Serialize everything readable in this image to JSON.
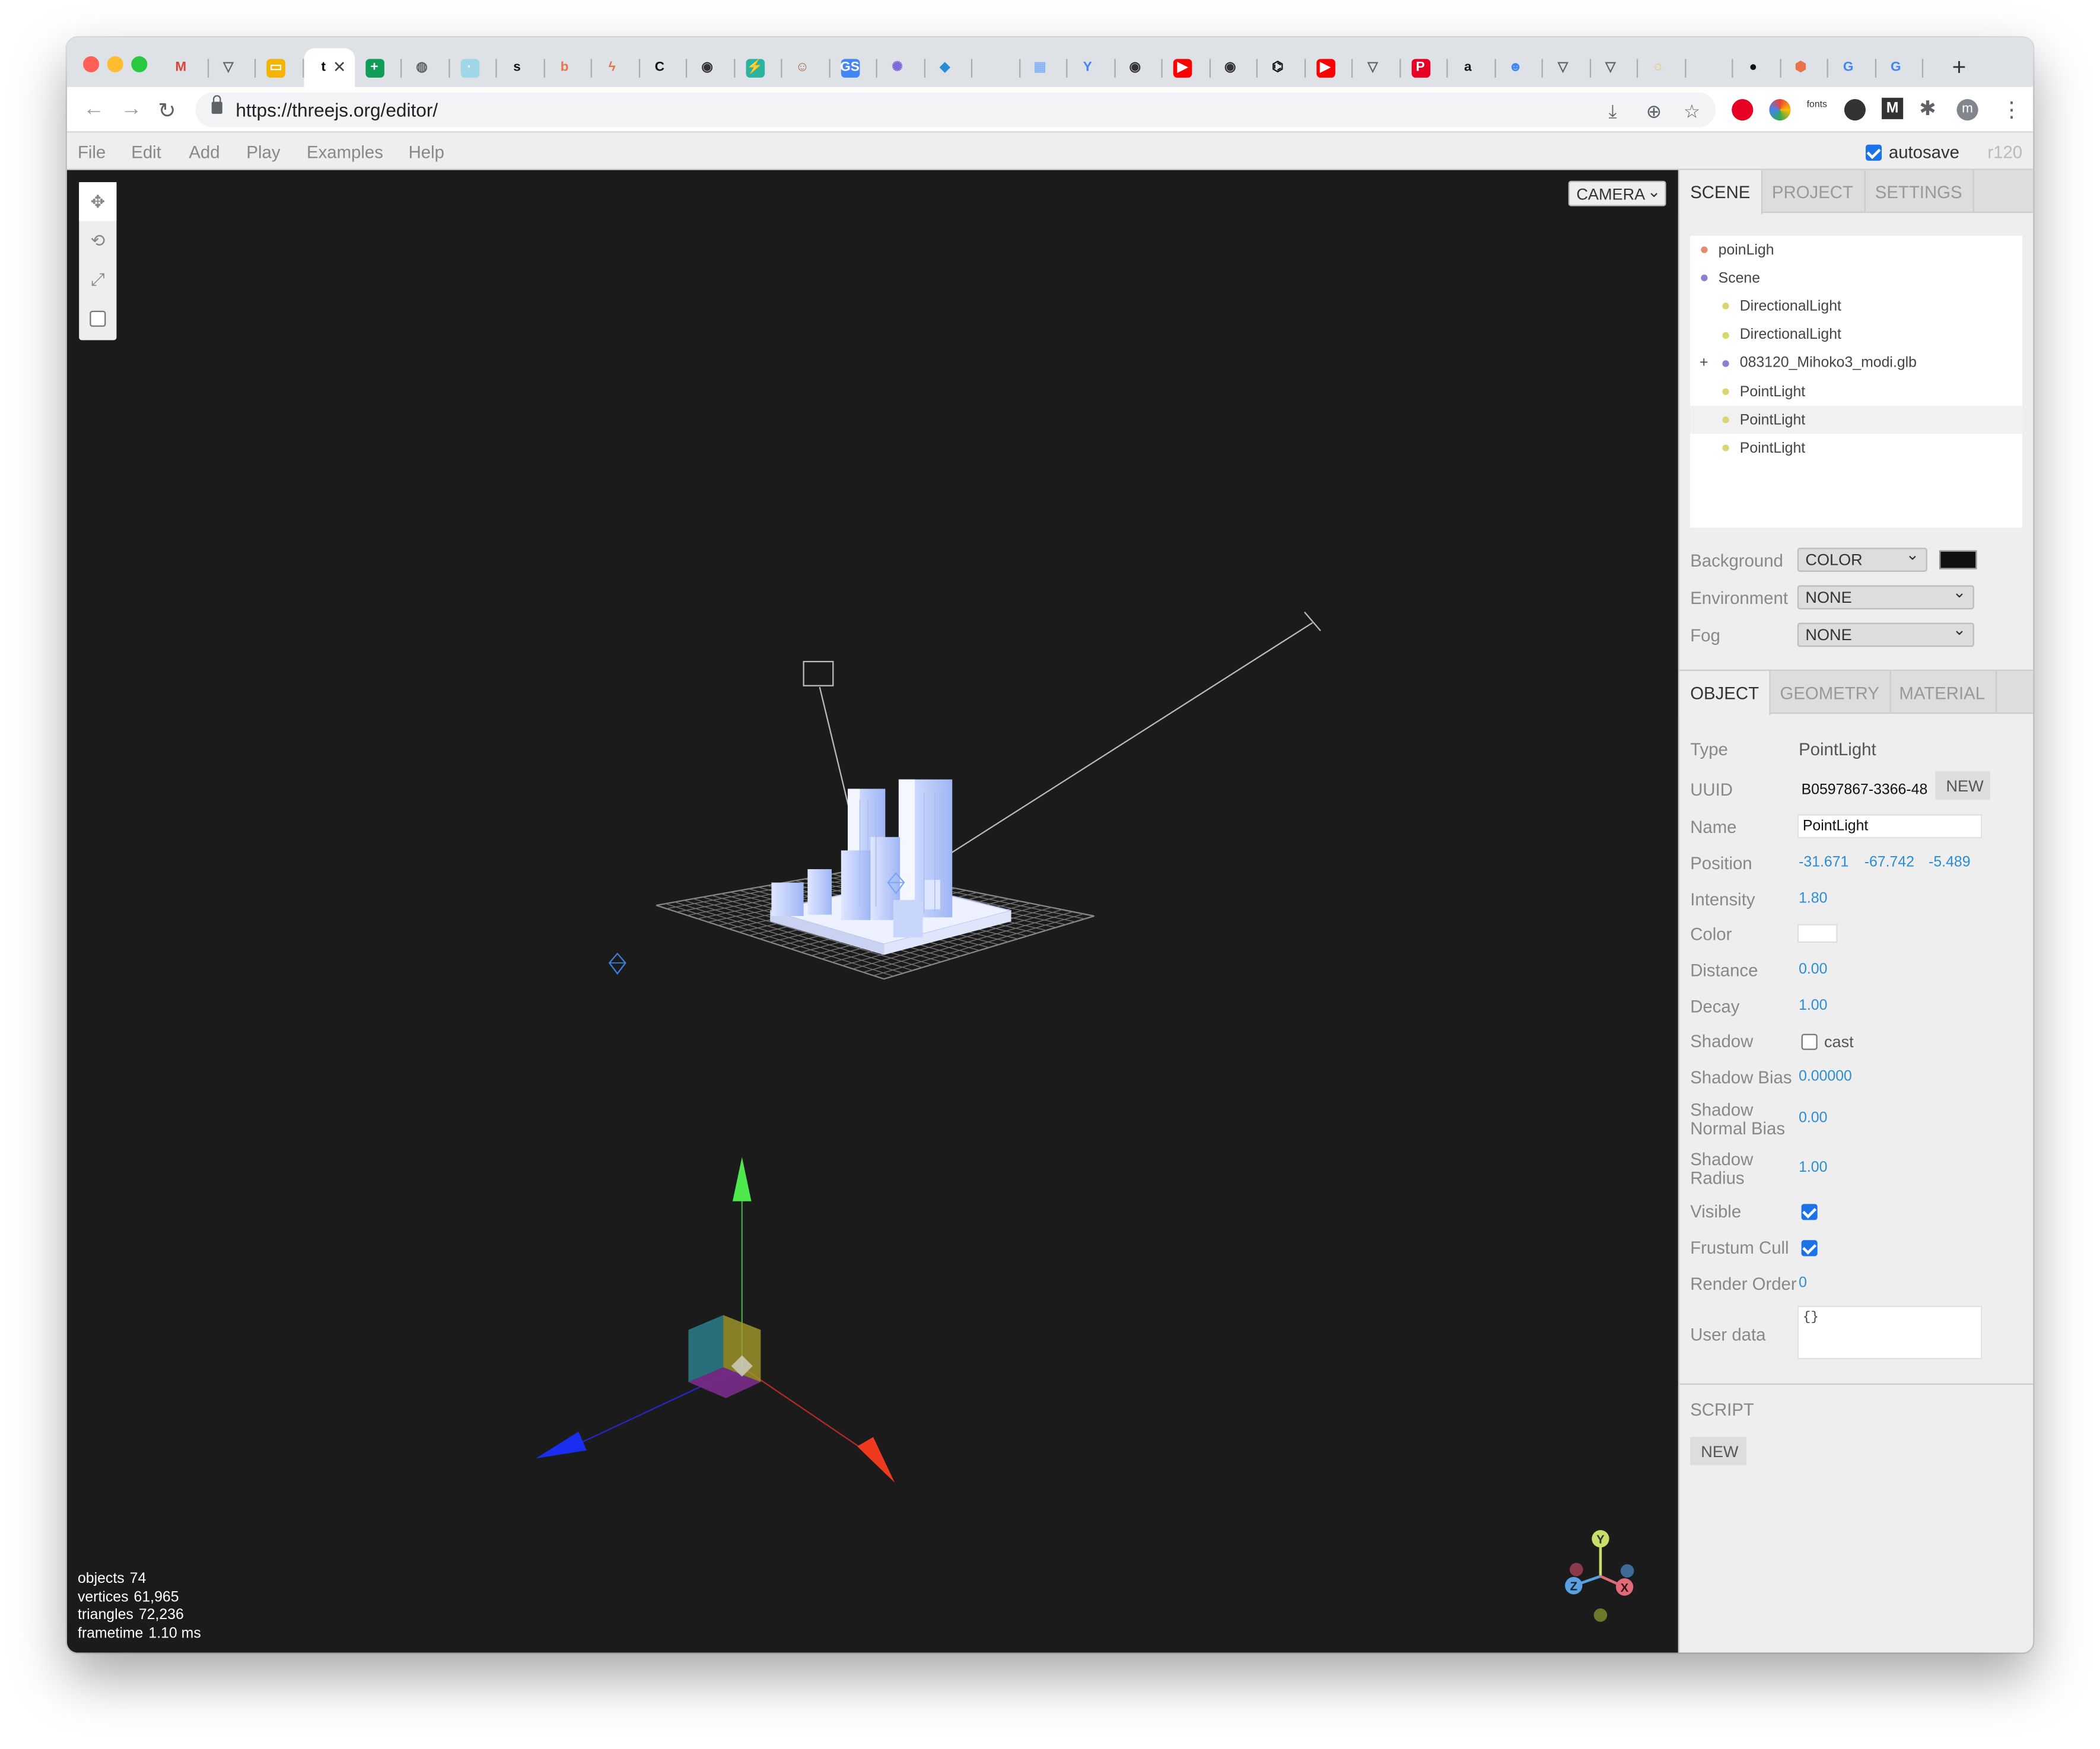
{
  "browser": {
    "address": "https://threejs.org/editor/",
    "active_tab_letter": "t",
    "tab_close": "✕",
    "new_tab": "+",
    "back_icon": "←",
    "forward_icon": "→",
    "reload_icon": "↻",
    "favicons": [
      {
        "letter": "M",
        "color": "#db4437"
      },
      {
        "letter": "▽",
        "color": "#5f6368"
      },
      {
        "letter": "▭",
        "color": "#f4b400"
      },
      {
        "letter": "t",
        "color": "#000000"
      },
      {
        "letter": "+",
        "color": "#0f9d58"
      },
      {
        "letter": "◍",
        "color": "#5f6368"
      },
      {
        "letter": "·",
        "color": "#9fd6e8"
      },
      {
        "letter": "s",
        "color": "#111111"
      },
      {
        "letter": "b",
        "color": "#e8734a"
      },
      {
        "letter": "ϟ",
        "color": "#e8734a"
      },
      {
        "letter": "C",
        "color": "#111111"
      },
      {
        "letter": "◉",
        "color": "#333333"
      },
      {
        "letter": "⚡",
        "color": "#2bb3a0"
      },
      {
        "letter": "☺",
        "color": "#a46a3c"
      },
      {
        "letter": "GS",
        "color": "#4285f4"
      },
      {
        "letter": "✺",
        "color": "#7c6ad6"
      },
      {
        "letter": "◆",
        "color": "#2a8dd4"
      },
      {
        "letter": "",
        "color": "#ffffff"
      },
      {
        "letter": "▦",
        "color": "#8ab4f8"
      },
      {
        "letter": "Y",
        "color": "#4285f4"
      },
      {
        "letter": "◉",
        "color": "#333333"
      },
      {
        "letter": "▶",
        "color": "#ff0000"
      },
      {
        "letter": "◉",
        "color": "#333333"
      },
      {
        "letter": "⌬",
        "color": "#111111"
      },
      {
        "letter": "▶",
        "color": "#ff0000"
      },
      {
        "letter": "▽",
        "color": "#5f6368"
      },
      {
        "letter": "P",
        "color": "#e60023"
      },
      {
        "letter": "a",
        "color": "#111111"
      },
      {
        "letter": "☻",
        "color": "#4285f4"
      },
      {
        "letter": "▽",
        "color": "#5f6368"
      },
      {
        "letter": "▽",
        "color": "#5f6368"
      },
      {
        "letter": "◌",
        "color": "#f4b400"
      },
      {
        "letter": "",
        "color": "#ffffff"
      },
      {
        "letter": "●",
        "color": "#111111"
      },
      {
        "letter": "⬢",
        "color": "#e8734a"
      },
      {
        "letter": "G",
        "color": "#4285f4"
      },
      {
        "letter": "G",
        "color": "#4285f4"
      }
    ],
    "extensions": {
      "download_icon": "⤓",
      "zoom_icon": "⊕",
      "star_icon": "☆",
      "fonts_label": "fonts",
      "avatar_letter": "m",
      "menu_icon": "⋮"
    }
  },
  "menubar": {
    "items": [
      "File",
      "Edit",
      "Add",
      "Play",
      "Examples",
      "Help"
    ],
    "autosave_label": "autosave",
    "autosave_checked": true,
    "revision": "r120"
  },
  "viewport": {
    "camera_select": "CAMERA",
    "tools": [
      "move-icon",
      "rotate-icon",
      "scale-icon",
      "local-icon"
    ],
    "stats": [
      {
        "label": "objects",
        "value": "74"
      },
      {
        "label": "vertices",
        "value": "61,965"
      },
      {
        "label": "triangles",
        "value": "72,236"
      },
      {
        "label": "frametime",
        "value": "1.10 ms"
      }
    ],
    "gizmo_labels": {
      "y": "Y",
      "z": "Z",
      "x": "X"
    }
  },
  "sidebar": {
    "tabs": [
      "SCENE",
      "PROJECT",
      "SETTINGS"
    ],
    "outliner": [
      {
        "label": "poinLigh",
        "color": "#e38b6f",
        "indent": 0,
        "opener": ""
      },
      {
        "label": "Scene",
        "color": "#8b7fd6",
        "indent": 0,
        "opener": ""
      },
      {
        "label": "DirectionalLight",
        "color": "#d8d66e",
        "indent": 1,
        "opener": ""
      },
      {
        "label": "DirectionalLight",
        "color": "#d8d66e",
        "indent": 1,
        "opener": ""
      },
      {
        "label": "083120_Mihoko3_modi.glb",
        "color": "#8b7fd6",
        "indent": 1,
        "opener": "+"
      },
      {
        "label": "PointLight",
        "color": "#d8d66e",
        "indent": 1,
        "opener": ""
      },
      {
        "label": "PointLight",
        "color": "#d8d66e",
        "indent": 1,
        "opener": ""
      },
      {
        "label": "PointLight",
        "color": "#d8d66e",
        "indent": 1,
        "opener": ""
      }
    ],
    "selected_row": 6,
    "scene_props": {
      "background_label": "Background",
      "background_value": "COLOR",
      "background_color": "#111111",
      "environment_label": "Environment",
      "environment_value": "NONE",
      "fog_label": "Fog",
      "fog_value": "NONE"
    },
    "object_tabs": [
      "OBJECT",
      "GEOMETRY",
      "MATERIAL"
    ],
    "object": {
      "type_label": "Type",
      "type_value": "PointLight",
      "uuid_label": "UUID",
      "uuid_value": "B0597867-3366-48",
      "uuid_new": "NEW",
      "name_label": "Name",
      "name_value": "PointLight",
      "position_label": "Position",
      "position": [
        "-31.671",
        "-67.742",
        "-5.489"
      ],
      "intensity_label": "Intensity",
      "intensity": "1.80",
      "color_label": "Color",
      "color_value": "#ffffff",
      "distance_label": "Distance",
      "distance": "0.00",
      "decay_label": "Decay",
      "decay": "1.00",
      "shadow_label": "Shadow",
      "shadow_cast": "cast",
      "shadow_bias_label": "Shadow Bias",
      "shadow_bias": "0.00000",
      "shadow_normal_label_1": "Shadow",
      "shadow_normal_label_2": "Normal Bias",
      "shadow_normal": "0.00",
      "shadow_radius_label_1": "Shadow",
      "shadow_radius_label_2": "Radius",
      "shadow_radius": "1.00",
      "visible_label": "Visible",
      "visible": true,
      "frustum_label": "Frustum Cull",
      "frustum": true,
      "render_order_label": "Render Order",
      "render_order": "0",
      "userdata_label": "User data",
      "userdata": "{}"
    },
    "script": {
      "title": "SCRIPT",
      "new_button": "NEW"
    }
  }
}
